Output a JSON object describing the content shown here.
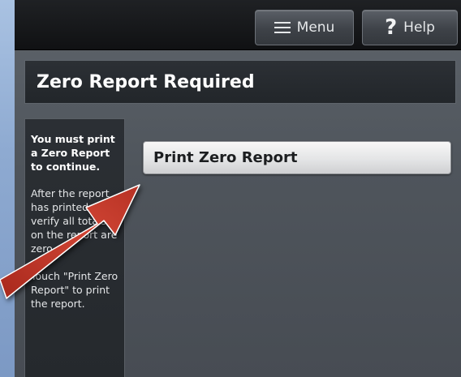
{
  "topbar": {
    "menu_label": "Menu",
    "help_label": "Help",
    "menu_icon": "hamburger-icon",
    "help_icon": "question-mark-icon",
    "help_glyph": "?"
  },
  "title": "Zero Report Required",
  "sidebar": {
    "instruction_bold": "You must print a Zero Report to continue.",
    "instruction_detail": "After the report has printed, verify all totals on the report are zero.",
    "instruction_touch": "Touch \"Print Zero Report\" to print the report."
  },
  "main": {
    "print_button_label": "Print Zero Report"
  },
  "annotation": {
    "type": "arrow",
    "color": "#c1392b",
    "points_to": "print-zero-report-button"
  }
}
